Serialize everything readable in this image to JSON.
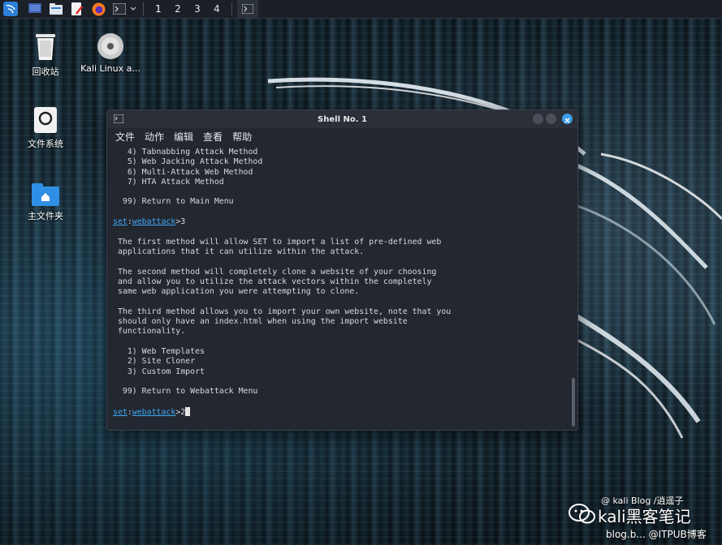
{
  "taskbar": {
    "workspaces": [
      "1",
      "2",
      "3",
      "4"
    ]
  },
  "desktop": {
    "icons": [
      {
        "label": "回收站"
      },
      {
        "label": "Kali Linux a..."
      },
      {
        "label": "文件系统"
      },
      {
        "label": "主文件夹"
      }
    ]
  },
  "window": {
    "title": "Shell No. 1",
    "menu": [
      "文件",
      "动作",
      "编辑",
      "查看",
      "帮助"
    ]
  },
  "terminal": {
    "lines": [
      "   4) Tabnabbing Attack Method",
      "   5) Web Jacking Attack Method",
      "   6) Multi-Attack Web Method",
      "   7) HTA Attack Method",
      "",
      "  99) Return to Main Menu",
      "",
      "",
      "",
      " The first method will allow SET to import a list of pre-defined web",
      " applications that it can utilize within the attack.",
      "",
      " The second method will completely clone a website of your choosing",
      " and allow you to utilize the attack vectors within the completely",
      " same web application you were attempting to clone.",
      "",
      " The third method allows you to import your own website, note that you",
      " should only have an index.html when using the import website",
      " functionality.",
      "",
      "   1) Web Templates",
      "   2) Site Cloner",
      "   3) Custom Import",
      "",
      "  99) Return to Webattack Menu",
      ""
    ],
    "prompt1": {
      "set": "set",
      "module": "webattack",
      "input": ">3"
    },
    "prompt2": {
      "set": "set",
      "module": "webattack",
      "input": ">2"
    }
  },
  "watermark": {
    "line1": "@ kali Blog /逍遥子",
    "line2": "kali黑客笔记",
    "line3": "blog.b... @ITPUB博客"
  }
}
